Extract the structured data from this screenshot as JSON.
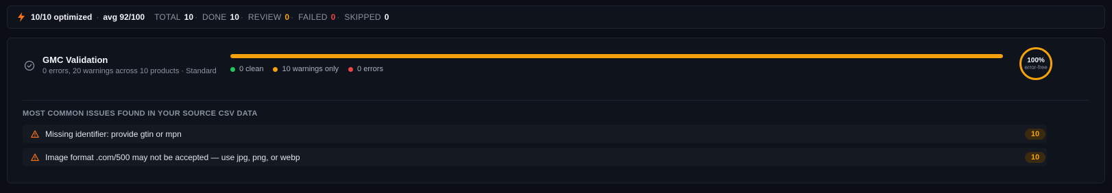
{
  "summary": {
    "optimized": "10/10 optimized",
    "separator": "·",
    "avg": "avg 92/100",
    "stats": [
      {
        "label": "TOTAL",
        "value": "10",
        "color": "#f2f4f8"
      },
      {
        "label": "DONE",
        "value": "10",
        "color": "#f2f4f8"
      },
      {
        "label": "REVIEW",
        "value": "0",
        "color": "#f5a20c"
      },
      {
        "label": "FAILED",
        "value": "0",
        "color": "#ef4444"
      },
      {
        "label": "SKIPPED",
        "value": "0",
        "color": "#f2f4f8"
      }
    ],
    "icon": "bolt-icon"
  },
  "validation": {
    "title": "GMC Validation",
    "subtitle": "0 errors, 20 warnings across 10 products · Standard",
    "progress_fraction": 1.0,
    "progress_color": "#f5a20c",
    "legend": [
      {
        "label": "0 clean",
        "color": "#22c55e"
      },
      {
        "label": "10 warnings only",
        "color": "#f5a20c"
      },
      {
        "label": "0 errors",
        "color": "#ef4444"
      }
    ],
    "score": "100%",
    "score_label": "error-free"
  },
  "issues": {
    "heading": "MOST COMMON ISSUES FOUND IN YOUR SOURCE CSV DATA",
    "items": [
      {
        "text": "Missing identifier: provide gtin or mpn",
        "count": "10",
        "icon": "warning-icon"
      },
      {
        "text": "Image format .com/500 may not be accepted — use jpg, png, or webp",
        "count": "10",
        "icon": "warning-icon"
      }
    ]
  }
}
